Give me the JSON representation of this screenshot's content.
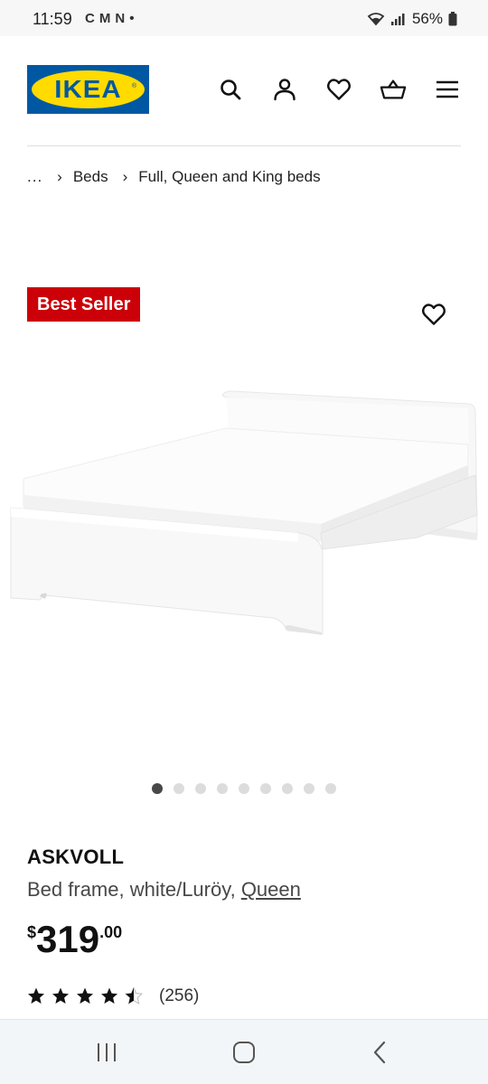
{
  "status_bar": {
    "time": "11:59",
    "app_icons": [
      "C",
      "M",
      "N",
      "•"
    ],
    "battery_percent": "56%"
  },
  "header": {
    "logo_text": "IKEA",
    "icons": [
      "search-icon",
      "account-icon",
      "favorites-icon",
      "basket-icon",
      "menu-icon"
    ]
  },
  "breadcrumb": {
    "items": [
      "...",
      "Beds",
      "Full, Queen and King beds"
    ]
  },
  "product": {
    "badge": "Best Seller",
    "name": "ASKVOLL",
    "description": "Bed frame, white/Luröy, ",
    "size": "Queen",
    "price": {
      "currency": "$",
      "integer": "319",
      "decimal": ".00"
    },
    "rating": {
      "stars": 4.5,
      "max": 5,
      "count": "(256)"
    }
  },
  "carousel": {
    "total_images": 9,
    "active_index": 0
  },
  "colors": {
    "ikea_blue": "#0058a3",
    "ikea_yellow": "#ffdb00",
    "badge_red": "#cc0008"
  },
  "nav_bar": {
    "buttons": [
      "recent-apps-icon",
      "home-icon",
      "back-icon"
    ]
  }
}
